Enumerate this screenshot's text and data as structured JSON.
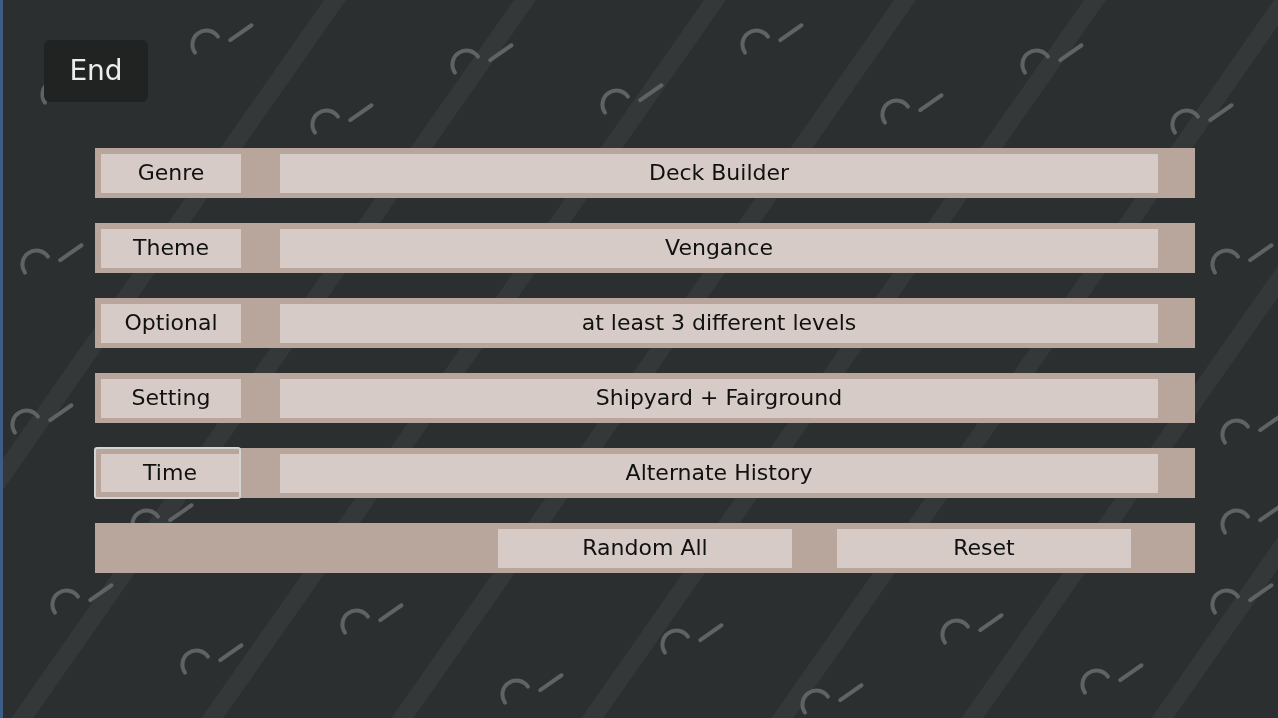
{
  "end_button": {
    "label": "End"
  },
  "rows": [
    {
      "label": "Genre",
      "value": "Deck Builder",
      "focused": false
    },
    {
      "label": "Theme",
      "value": "Vengance",
      "focused": false
    },
    {
      "label": "Optional",
      "value": "at least 3 different levels",
      "focused": false
    },
    {
      "label": "Setting",
      "value": "Shipyard + Fairground",
      "focused": false
    },
    {
      "label": "Time",
      "value": "Alternate History",
      "focused": true
    }
  ],
  "actions": [
    {
      "label": "Random All"
    },
    {
      "label": "Reset"
    }
  ]
}
